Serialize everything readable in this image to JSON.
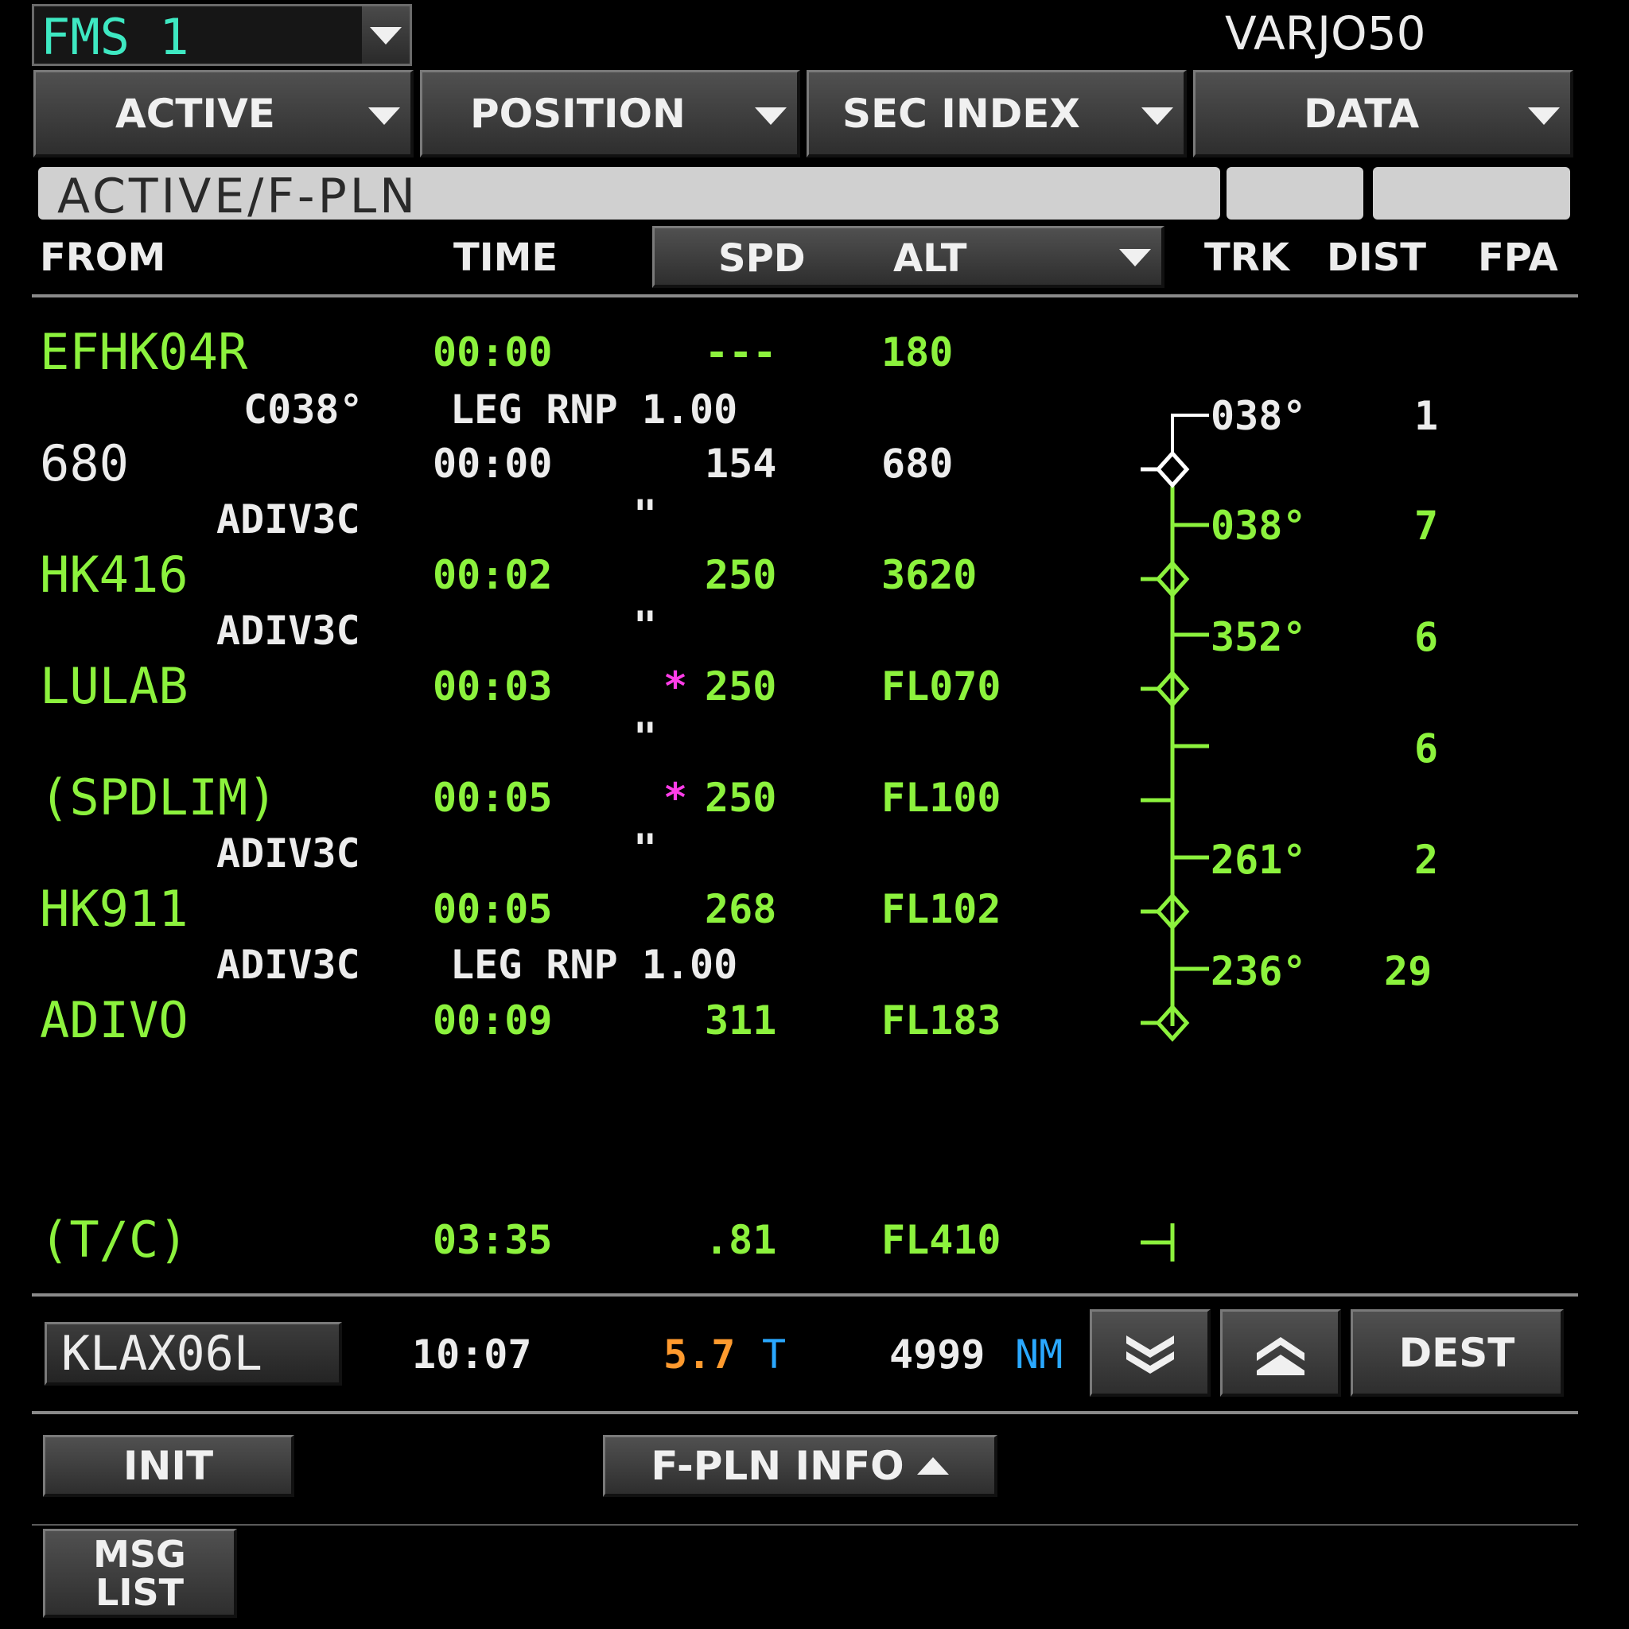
{
  "header": {
    "fms_selector": "FMS 1",
    "flight_id": "VARJO50"
  },
  "tabs": [
    {
      "label": "ACTIVE"
    },
    {
      "label": "POSITION"
    },
    {
      "label": "SEC INDEX"
    },
    {
      "label": "DATA"
    }
  ],
  "page_title": "ACTIVE/F-PLN",
  "columns": {
    "from": "FROM",
    "time": "TIME",
    "spd": "SPD",
    "alt": "ALT",
    "trk": "TRK",
    "dist": "DIST",
    "fpa": "FPA"
  },
  "waypoints": [
    {
      "name": "EFHK04R",
      "time": "00:00",
      "spd": "---",
      "alt": "180"
    },
    {
      "name": "680",
      "time": "00:00",
      "spd": "154",
      "alt": "680"
    },
    {
      "name": "HK416",
      "time": "00:02",
      "spd": "250",
      "alt": "3620"
    },
    {
      "name": "LULAB",
      "time": "00:03",
      "spd": "250",
      "alt": "FL070",
      "spd_marker": "*"
    },
    {
      "name": "(SPDLIM)",
      "time": "00:05",
      "spd": "250",
      "alt": "FL100",
      "spd_marker": "*"
    },
    {
      "name": "HK911",
      "time": "00:05",
      "spd": "268",
      "alt": "FL102"
    },
    {
      "name": "ADIVO",
      "time": "00:09",
      "spd": "311",
      "alt": "FL183"
    },
    {
      "name": "(T/C)",
      "time": "03:35",
      "spd": ".81",
      "alt": "FL410"
    }
  ],
  "legs": [
    {
      "airway": "C038°",
      "info": "LEG RNP 1.00",
      "trk": "038°",
      "dist": "1"
    },
    {
      "airway": "ADIV3C",
      "info": "\"",
      "trk": "038°",
      "dist": "7"
    },
    {
      "airway": "ADIV3C",
      "info": "\"",
      "trk": "352°",
      "dist": "6"
    },
    {
      "airway": "",
      "info": "\"",
      "trk": "",
      "dist": "6"
    },
    {
      "airway": "ADIV3C",
      "info": "\"",
      "trk": "261°",
      "dist": "2"
    },
    {
      "airway": "ADIV3C",
      "info": "LEG RNP 1.00",
      "trk": "236°",
      "dist": "29"
    }
  ],
  "destination": {
    "airport": "KLAX06L",
    "time": "10:07",
    "efob": "5.7",
    "efob_unit": "T",
    "dist": "4999",
    "dist_unit": "NM"
  },
  "buttons": {
    "dest": "DEST",
    "init": "INIT",
    "fpln_info": "F-PLN INFO",
    "msg_list_1": "MSG",
    "msg_list_2": "LIST"
  },
  "colors": {
    "green": "#8cf23d",
    "white": "#ececec",
    "cyan": "#3ee8c2",
    "amber": "#ff9a2e",
    "blue": "#2aa8ff",
    "magenta": "#ff3de8"
  }
}
